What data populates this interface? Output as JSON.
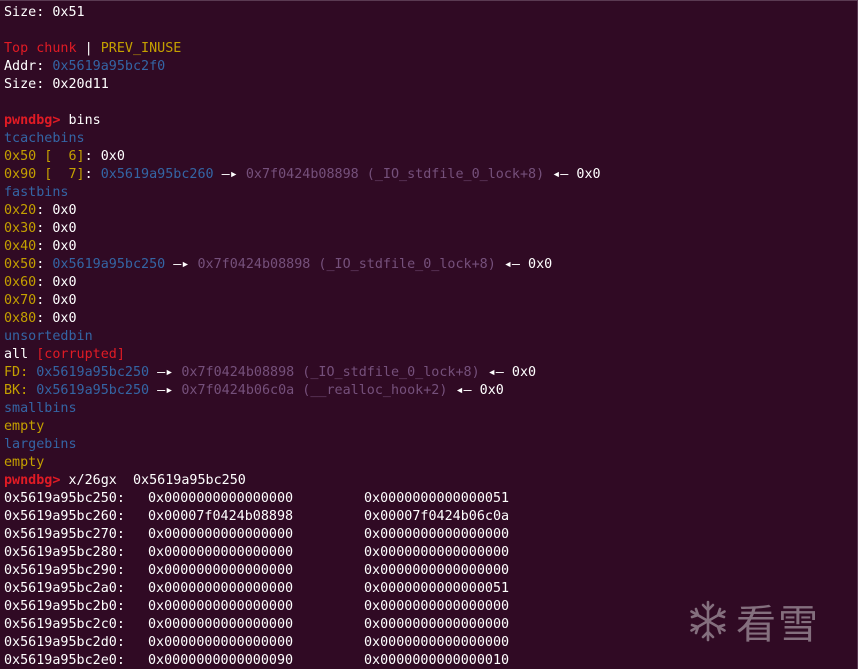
{
  "top_size": {
    "label": "Size: ",
    "value": "0x51"
  },
  "top_chunk": {
    "name": "Top chunk",
    "sep": " | ",
    "flag": "PREV_INUSE",
    "addr_label": "Addr: ",
    "addr": "0x5619a95bc2f0",
    "size_label": "Size: ",
    "size": "0x20d11"
  },
  "prompt": "pwndbg>",
  "cmd1": " bins",
  "tcache": {
    "title": "tcachebins",
    "r1": {
      "key": "0x50 [  6]",
      "rest": ": 0x0"
    },
    "r2": {
      "key": "0x90 [  7]",
      "colon": ": ",
      "addr": "0x5619a95bc260",
      "arrow": " —▸ ",
      "target": "0x7f0424b08898 (_IO_stdfile_0_lock+8)",
      "back": " ◂— ",
      "tail": "0x0"
    }
  },
  "fast": {
    "title": "fastbins",
    "r20": {
      "key": "0x20",
      "rest": ": 0x0"
    },
    "r30": {
      "key": "0x30",
      "rest": ": 0x0"
    },
    "r40": {
      "key": "0x40",
      "rest": ": 0x0"
    },
    "r50": {
      "key": "0x50",
      "colon": ": ",
      "addr": "0x5619a95bc250",
      "arrow": " —▸ ",
      "target": "0x7f0424b08898 (_IO_stdfile_0_lock+8)",
      "back": " ◂— ",
      "tail": "0x0"
    },
    "r60": {
      "key": "0x60",
      "rest": ": 0x0"
    },
    "r70": {
      "key": "0x70",
      "rest": ": 0x0"
    },
    "r80": {
      "key": "0x80",
      "rest": ": 0x0"
    }
  },
  "unsorted": {
    "title": "unsortedbin",
    "all": "all ",
    "corrupted": "[corrupted]",
    "fd": {
      "key": "FD: ",
      "addr": "0x5619a95bc250",
      "arrow": " —▸ ",
      "target": "0x7f0424b08898 (_IO_stdfile_0_lock+8)",
      "back": " ◂— ",
      "tail": "0x0"
    },
    "bk": {
      "key": "BK: ",
      "addr": "0x5619a95bc250",
      "arrow": " —▸ ",
      "target": "0x7f0424b06c0a (__realloc_hook+2)",
      "back": " ◂— ",
      "tail": "0x0"
    }
  },
  "small": {
    "title": "smallbins",
    "empty": "empty"
  },
  "large": {
    "title": "largebins",
    "empty": "empty"
  },
  "cmd2": " x/26gx  0x5619a95bc250",
  "memory": [
    {
      "addr": "0x5619a95bc250:",
      "v1": "0x0000000000000000",
      "v2": "0x0000000000000051"
    },
    {
      "addr": "0x5619a95bc260:",
      "v1": "0x00007f0424b08898",
      "v2": "0x00007f0424b06c0a"
    },
    {
      "addr": "0x5619a95bc270:",
      "v1": "0x0000000000000000",
      "v2": "0x0000000000000000"
    },
    {
      "addr": "0x5619a95bc280:",
      "v1": "0x0000000000000000",
      "v2": "0x0000000000000000"
    },
    {
      "addr": "0x5619a95bc290:",
      "v1": "0x0000000000000000",
      "v2": "0x0000000000000000"
    },
    {
      "addr": "0x5619a95bc2a0:",
      "v1": "0x0000000000000000",
      "v2": "0x0000000000000051"
    },
    {
      "addr": "0x5619a95bc2b0:",
      "v1": "0x0000000000000000",
      "v2": "0x0000000000000000"
    },
    {
      "addr": "0x5619a95bc2c0:",
      "v1": "0x0000000000000000",
      "v2": "0x0000000000000000"
    },
    {
      "addr": "0x5619a95bc2d0:",
      "v1": "0x0000000000000000",
      "v2": "0x0000000000000000"
    },
    {
      "addr": "0x5619a95bc2e0:",
      "v1": "0x0000000000000090",
      "v2": "0x0000000000000010"
    }
  ],
  "watermark": {
    "text": "看雪",
    "icon": "snowflake-icon"
  },
  "colors": {
    "background": "#300a24",
    "prompt": "#e01b24",
    "address": "#3465a4",
    "symbol": "#75507b",
    "bin_size": "#c4a000"
  }
}
